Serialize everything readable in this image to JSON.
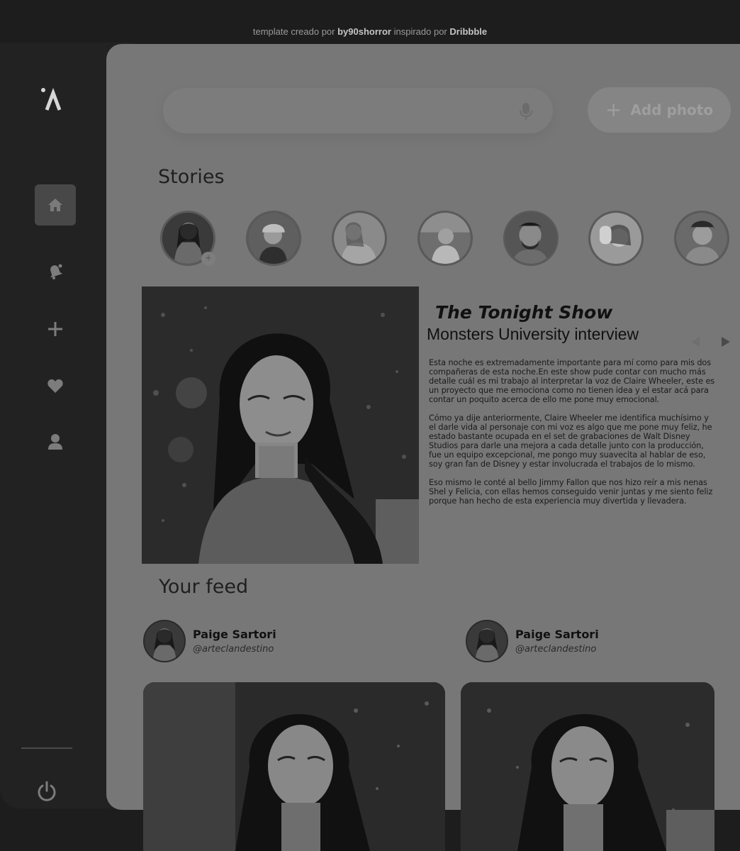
{
  "credit": {
    "prefix": "template creado por",
    "author": "by90shorror",
    "middle": "inspirado por",
    "source": "Dribbble"
  },
  "sidebar": {
    "items": [
      {
        "name": "home",
        "icon": "home-icon",
        "active": true
      },
      {
        "name": "notifications",
        "icon": "bell-icon",
        "active": false
      },
      {
        "name": "add",
        "icon": "plus-icon",
        "active": false
      },
      {
        "name": "favorites",
        "icon": "heart-icon",
        "active": false
      },
      {
        "name": "profile",
        "icon": "user-icon",
        "active": false
      }
    ],
    "logout_icon": "power-icon"
  },
  "header": {
    "search_placeholder": "",
    "add_photo_label": "Add photo"
  },
  "stories": {
    "title": "Stories",
    "count": 7
  },
  "feature": {
    "title": "The Tonight Show",
    "subtitle": "Monsters University interview",
    "paragraphs": [
      "Esta noche es extremadamente importante para mí como para mis dos compañeras de esta noche.En este show pude contar con mucho más detalle cuál es mi trabajo al interpretar la voz de Claire Wheeler, este es un proyecto que me emociona como no tienen idea y el estar acá para contar un poquito acerca de ello me pone muy emocional.",
      "Cómo ya dije anteriormente, Claire Wheeler me identifica muchísimo y el darle vida al personaje con mi voz es algo que me pone muy feliz, he estado bastante ocupada en el set de grabaciones de Walt Disney Studios para darle una mejora a cada detalle junto con la producción, fue un equipo excepcional, me pongo muy suavecita al hablar de eso, soy gran fan de Disney y estar involucrada el trabajos de lo mismo.",
      "Eso mismo le conté al bello Jimmy Fallon que nos hizo reír a mis nenas Shel y Felicia, con ellas hemos conseguido venir juntas y me siento feliz porque han hecho de esta experiencia muy divertida y llevadera."
    ]
  },
  "feed": {
    "title": "Your feed",
    "posts": [
      {
        "name": "Paige Sartori",
        "handle": "@arteclandestino"
      },
      {
        "name": "Paige Sartori",
        "handle": "@arteclandestino"
      }
    ]
  },
  "colors": {
    "page_bg": "#1d1d1d",
    "sidebar_bg": "#222222",
    "main_bg": "#777777",
    "active_nav": "#484848"
  }
}
